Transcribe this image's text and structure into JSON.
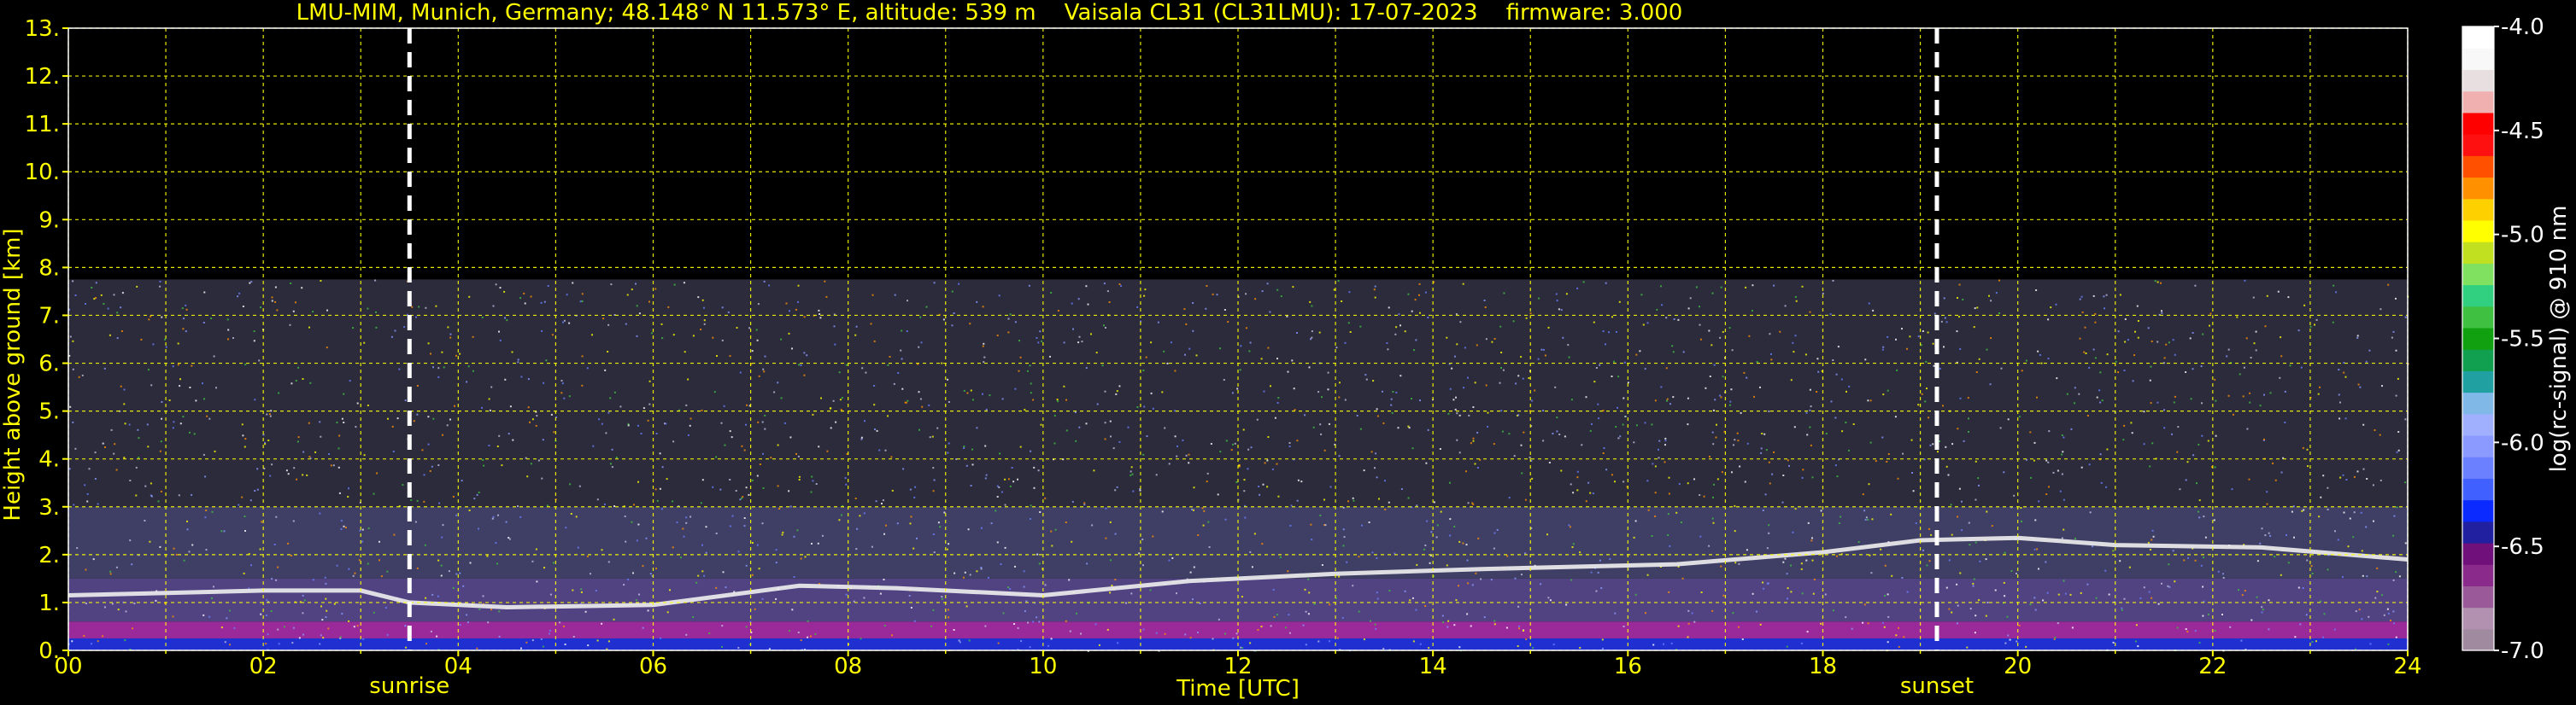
{
  "title": "LMU-MIM, Munich, Germany; 48.148° N 11.573° E, altitude: 539 m    Vaisala CL31 (CL31LMU): 17-07-2023    firmware: 3.000",
  "chart_data": {
    "type": "heatmap",
    "xlabel": "Time [UTC]",
    "ylabel": "Height above ground [km]",
    "xlim": [
      0,
      24
    ],
    "ylim": [
      0,
      13
    ],
    "x_ticks": [
      "00",
      "02",
      "04",
      "06",
      "08",
      "10",
      "12",
      "14",
      "16",
      "18",
      "20",
      "22",
      "24"
    ],
    "y_ticks": [
      "0.",
      "1.",
      "2.",
      "3.",
      "4.",
      "5.",
      "6.",
      "7.",
      "8.",
      "9.",
      "10.",
      "11.",
      "12.",
      "13."
    ],
    "grid": true,
    "grid_color": "#ffff00",
    "data_top_km": 7.75,
    "events": [
      {
        "label": "sunrise",
        "x": 3.5
      },
      {
        "label": "sunset",
        "x": 19.17
      }
    ],
    "boundary_layer": [
      {
        "x": 0.0,
        "y": 1.15
      },
      {
        "x": 1.0,
        "y": 1.2
      },
      {
        "x": 2.0,
        "y": 1.25
      },
      {
        "x": 3.0,
        "y": 1.25
      },
      {
        "x": 3.5,
        "y": 1.0
      },
      {
        "x": 4.5,
        "y": 0.9
      },
      {
        "x": 6.0,
        "y": 0.95
      },
      {
        "x": 7.5,
        "y": 1.35
      },
      {
        "x": 8.5,
        "y": 1.3
      },
      {
        "x": 10.0,
        "y": 1.15
      },
      {
        "x": 11.5,
        "y": 1.45
      },
      {
        "x": 13.0,
        "y": 1.6
      },
      {
        "x": 14.5,
        "y": 1.7
      },
      {
        "x": 16.5,
        "y": 1.8
      },
      {
        "x": 18.0,
        "y": 2.05
      },
      {
        "x": 19.0,
        "y": 2.3
      },
      {
        "x": 20.0,
        "y": 2.35
      },
      {
        "x": 21.0,
        "y": 2.2
      },
      {
        "x": 22.5,
        "y": 2.15
      },
      {
        "x": 24.0,
        "y": 1.9
      }
    ],
    "colorbar": {
      "label": "log(rc-signal) @ 910 nm",
      "range": [
        -7.0,
        -4.0
      ],
      "ticks": [
        "-4.0",
        "-4.5",
        "-5.0",
        "-5.5",
        "-6.0",
        "-6.5",
        "-7.0"
      ],
      "tick_values": [
        -4.0,
        -4.5,
        -5.0,
        -5.5,
        -6.0,
        -6.5,
        -7.0
      ],
      "colors": [
        "#a08aa0",
        "#b290b0",
        "#9a5a9a",
        "#8a2a8a",
        "#70107a",
        "#2020a0",
        "#0a2aff",
        "#4060ff",
        "#6a80ff",
        "#8a9aff",
        "#a0b0ff",
        "#80b8e8",
        "#20a0a0",
        "#10a050",
        "#10a010",
        "#40c040",
        "#30d080",
        "#80e060",
        "#c0e020",
        "#ffff00",
        "#ffd000",
        "#ff9000",
        "#ff5000",
        "#ff1010",
        "#ff0000",
        "#f0b0b0",
        "#e8e0e0",
        "#f8f8f8",
        "#ffffff"
      ]
    }
  }
}
